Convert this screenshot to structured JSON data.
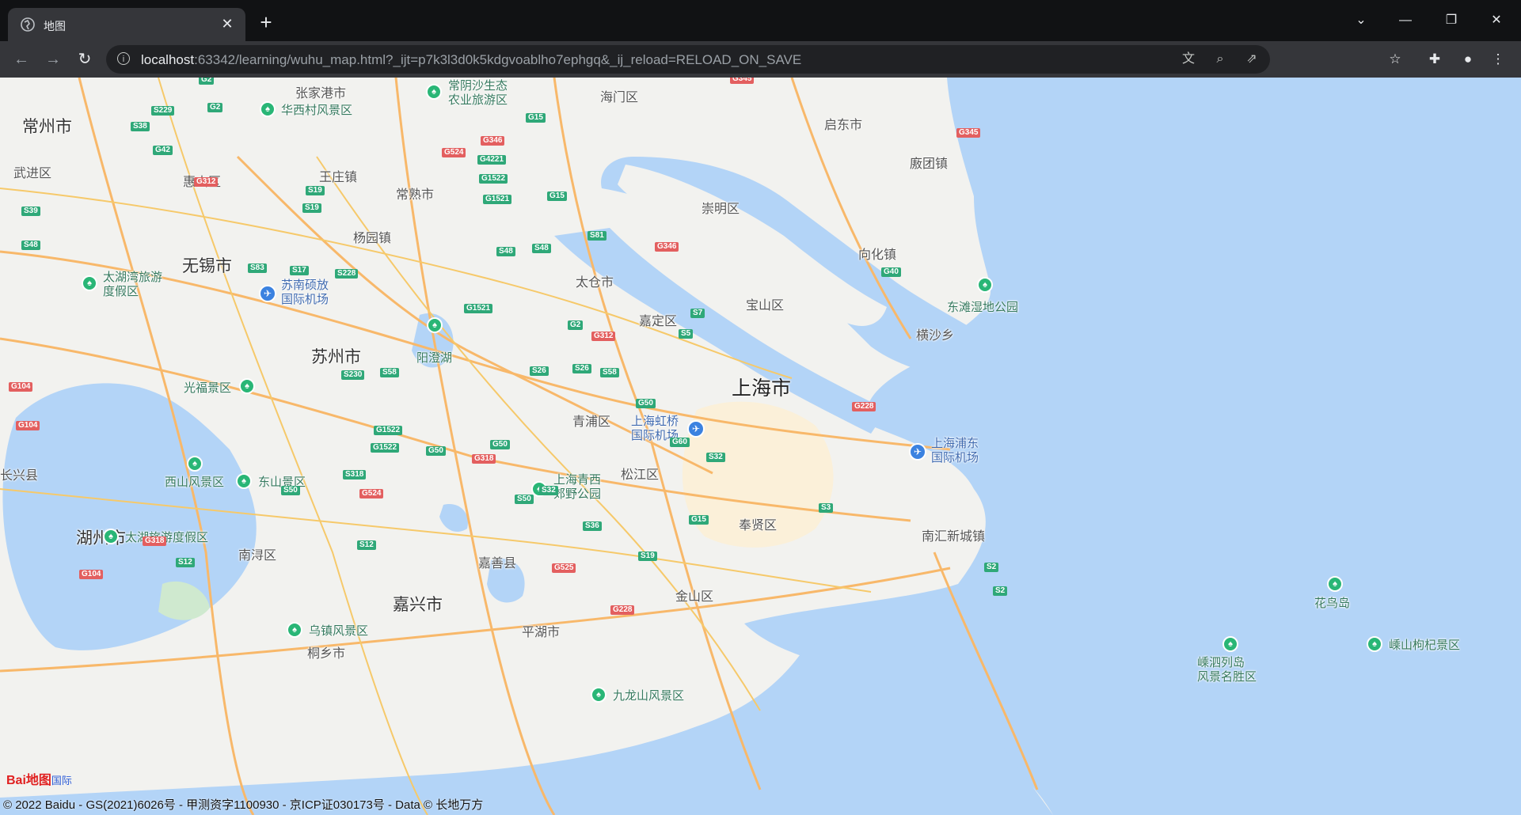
{
  "browser": {
    "tab_title": "地图",
    "tab_close": "✕",
    "new_tab": "+",
    "url_host": "localhost",
    "url_rest": ":63342/learning/wuhu_map.html?_ijt=p7k3l3d0k5kdgvoablho7ephgq&_ij_reload=RELOAD_ON_SAVE"
  },
  "map": {
    "cities": [
      {
        "name": "常州市"
      },
      {
        "name": "无锡市"
      },
      {
        "name": "苏州市"
      },
      {
        "name": "湖州市"
      },
      {
        "name": "嘉兴市"
      }
    ],
    "main_city": "上海市",
    "districts": [
      "张家港市",
      "海门区",
      "启东市",
      "武进区",
      "惠山区",
      "王庄镇",
      "常熟市",
      "崇明区",
      "廒团镇",
      "杨园镇",
      "向化镇",
      "太仓市",
      "宝山区",
      "嘉定区",
      "横沙乡",
      "青浦区",
      "松江区",
      "长兴县",
      "奉贤区",
      "南汇新城镇",
      "南浔区",
      "嘉善县",
      "金山区",
      "平湖市",
      "桐乡市"
    ],
    "parks": [
      "常阴沙生态\n农业旅游区",
      "华西村风景区",
      "太湖湾旅游\n度假区",
      "东滩湿地公园",
      "阳澄湖",
      "光福景区",
      "西山风景区",
      "东山景区",
      "上海青西\n郊野公园",
      "太湖旅游度假区",
      "乌镇风景区",
      "九龙山风景区",
      "花鸟岛",
      "嵊泗列岛\n风景名胜区",
      "嵊山枸杞景区"
    ],
    "airports": [
      "苏南硕放\n国际机场",
      "上海虹桥\n国际机场",
      "上海浦东\n国际机场"
    ],
    "shields_green": [
      "G2",
      "S229",
      "S38",
      "G42",
      "G2",
      "G15",
      "G4221",
      "G1522",
      "G1521",
      "S19",
      "S19",
      "G15",
      "S39",
      "S81",
      "S48",
      "S48",
      "S48",
      "S83",
      "S17",
      "S228",
      "G1521",
      "S7",
      "G2",
      "S5",
      "S58",
      "S26",
      "S26",
      "S230",
      "S58",
      "G50",
      "G60",
      "G1522",
      "G1522",
      "G50",
      "G50",
      "S32",
      "S318",
      "S50",
      "S12",
      "S32",
      "S3",
      "S36",
      "G15",
      "S50",
      "S12",
      "S19",
      "S2",
      "S2",
      "G40"
    ],
    "shields_red": [
      "G345",
      "G346",
      "G524",
      "G312",
      "G346",
      "G312",
      "G104",
      "G104",
      "G318",
      "G524",
      "G318",
      "G104",
      "G525",
      "G228",
      "G228",
      "G345"
    ],
    "logo_text": "Bai地图",
    "logo_extra": "国际",
    "copyright": "© 2022 Baidu - GS(2021)6026号 - 甲测资字1100930 - 京ICP证030173号 - Data © 长地万方"
  },
  "colors": {
    "water": "#b3d4f7",
    "land": "#f2f2ef",
    "road": "#f8b86a",
    "highway": "#f6c96a",
    "green": "#cfe9cf"
  }
}
